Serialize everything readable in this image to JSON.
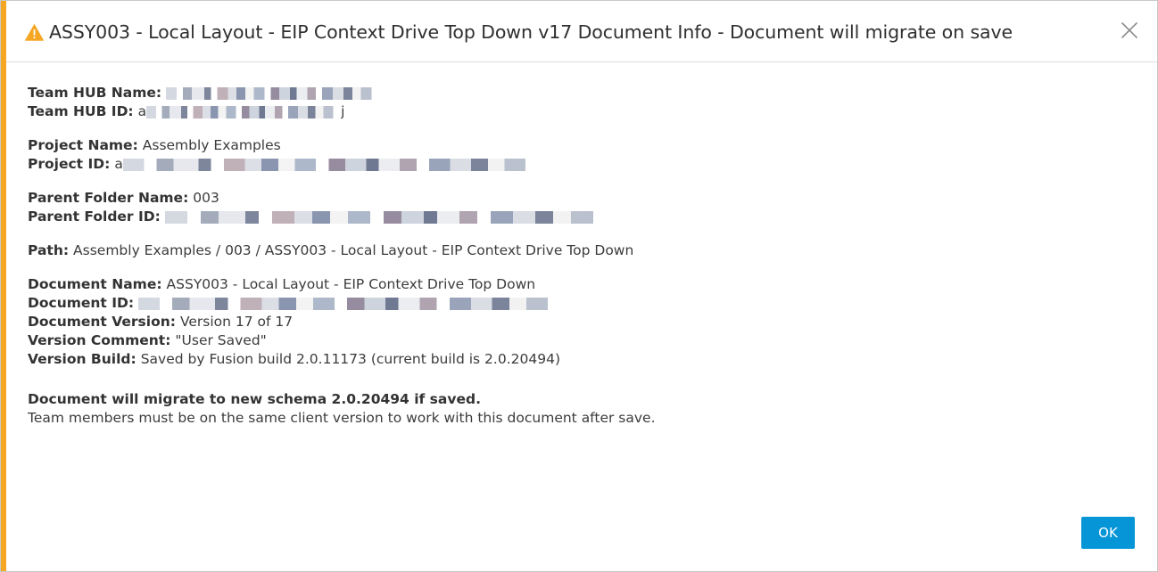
{
  "dialog": {
    "title": "ASSY003 - Local Layout - EIP Context Drive Top Down v17 Document Info - Document will migrate on save",
    "icon": "warning-icon",
    "accent_color": "#f5a623"
  },
  "info": {
    "team_hub_name": {
      "label": "Team HUB Name:"
    },
    "team_hub_id": {
      "label": "Team HUB ID:",
      "value_prefix": "a",
      "value_suffix": "j"
    },
    "project_name": {
      "label": "Project Name:",
      "value": "Assembly Examples"
    },
    "project_id": {
      "label": "Project ID:",
      "value_prefix": "a"
    },
    "parent_folder_name": {
      "label": "Parent Folder Name:",
      "value": "003"
    },
    "parent_folder_id": {
      "label": "Parent Folder ID:"
    },
    "path": {
      "label": "Path:",
      "value": "Assembly Examples / 003 / ASSY003 - Local Layout - EIP Context Drive Top Down"
    },
    "document_name": {
      "label": "Document Name:",
      "value": "ASSY003 - Local Layout - EIP Context Drive Top Down"
    },
    "document_id": {
      "label": "Document ID:"
    },
    "document_version": {
      "label": "Document Version:",
      "value": "Version 17 of 17"
    },
    "version_comment": {
      "label": "Version Comment:",
      "value": "\"User Saved\""
    },
    "version_build": {
      "label": "Version Build:",
      "value": "Saved by Fusion build 2.0.11173 (current build is 2.0.20494)"
    }
  },
  "migration": {
    "heading": "Document will migrate to new schema 2.0.20494 if saved.",
    "note": "Team members must be on the same client version to work with this document after save."
  },
  "buttons": {
    "ok_label": "OK",
    "ok_color": "#0696d7"
  }
}
